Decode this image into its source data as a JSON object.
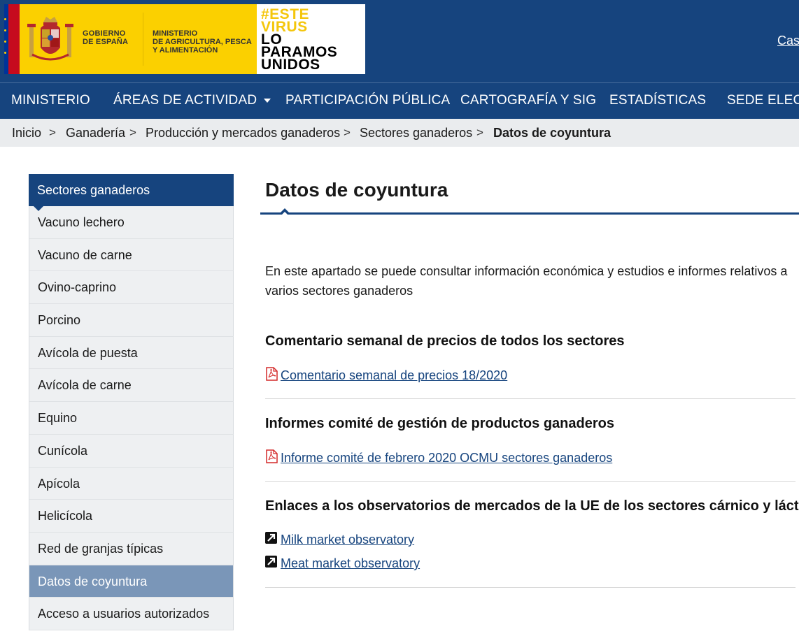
{
  "header": {
    "gov_line1": "GOBIERNO",
    "gov_line2": "DE ESPAÑA",
    "min_line1": "MINISTERIO",
    "min_line2": "DE AGRICULTURA, PESCA",
    "min_line3": "Y ALIMENTACIÓN",
    "virus_line1": "#ESTE",
    "virus_line2": "VIRUS",
    "virus_line3": "LO",
    "virus_line4": "PARAMOS",
    "virus_line5": "UNIDOS",
    "language": "Cas"
  },
  "nav": {
    "items": [
      "MINISTERIO",
      "ÁREAS DE ACTIVIDAD",
      "PARTICIPACIÓN PÚBLICA",
      "CARTOGRAFÍA Y SIG",
      "ESTADÍSTICAS",
      "SEDE ELECTR"
    ]
  },
  "breadcrumb": {
    "items": [
      "Inicio",
      "Ganadería",
      "Producción y mercados ganaderos",
      "Sectores ganaderos",
      "Datos de coyuntura"
    ],
    "separator": ">"
  },
  "sidebar": {
    "title": "Sectores ganaderos",
    "items": [
      "Vacuno lechero",
      "Vacuno de carne",
      "Ovino-caprino",
      "Porcino",
      "Avícola de puesta",
      "Avícola de carne",
      "Equino",
      "Cunícola",
      "Apícola",
      "Helicícola",
      "Red de granjas típicas",
      "Datos de coyuntura",
      "Acceso a usuarios autorizados"
    ],
    "active_item": "Datos de coyuntura"
  },
  "main": {
    "title": "Datos de coyuntura",
    "intro": "En este apartado se puede consultar información económica y estudios e informes relativos a varios sectores ganaderos",
    "sections": [
      {
        "heading": "Comentario semanal de precios de todos los sectores",
        "links": [
          {
            "icon": "pdf-icon",
            "label": "Comentario semanal de precios 18/2020"
          }
        ]
      },
      {
        "heading": "Informes comité de gestión de productos ganaderos",
        "links": [
          {
            "icon": "pdf-icon",
            "label": "Informe comité de febrero 2020 OCMU sectores ganaderos"
          }
        ]
      },
      {
        "heading": "Enlaces a los observatorios de mercados de la UE de los sectores cárnico y lácteo.",
        "links": [
          {
            "icon": "external-link-icon",
            "label": "Milk market observatory"
          },
          {
            "icon": "external-link-icon",
            "label": "Meat market observatory"
          }
        ]
      }
    ]
  },
  "colors": {
    "brand_blue": "#16447e",
    "flag_yellow": "#fbd000",
    "flag_red": "#c60b1e",
    "active_sidebar": "#7a96b8",
    "pdf_red": "#d42a2a"
  }
}
